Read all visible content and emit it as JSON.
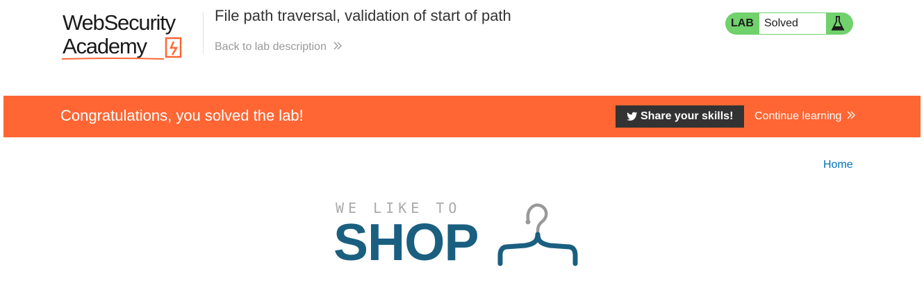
{
  "header": {
    "logo": {
      "line1": "WebSecurity",
      "line2": "Academy"
    },
    "lab_title": "File path traversal, validation of start of path",
    "back_link": "Back to lab description",
    "status": {
      "label": "LAB",
      "value": "Solved"
    }
  },
  "banner": {
    "message": "Congratulations, you solved the lab!",
    "share_label": "Share your skills!",
    "continue_label": "Continue learning"
  },
  "nav": {
    "home_label": "Home"
  },
  "shop_logo": {
    "tagline": "WE LIKE TO",
    "word": "SHOP"
  },
  "colors": {
    "accent": "#ff6633",
    "solved_green": "#70d16d",
    "link_blue": "#0071bc",
    "shop_blue": "#1a5f80"
  }
}
